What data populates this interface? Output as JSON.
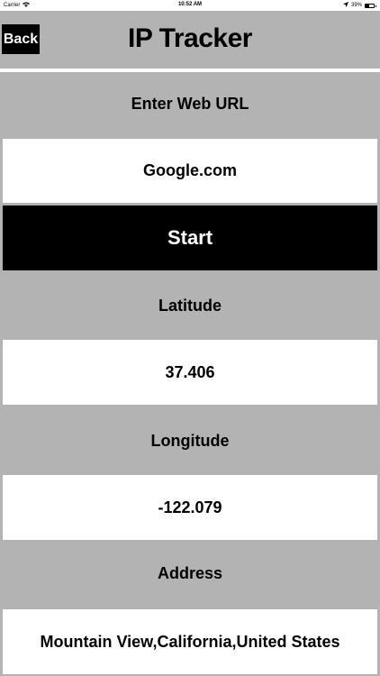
{
  "status_bar": {
    "carrier": "Carrier",
    "time": "10:52 AM",
    "battery": "39%",
    "battery_level": 0.39
  },
  "header": {
    "back_label": "Back",
    "title": "IP Tracker"
  },
  "form": {
    "url_label": "Enter Web URL",
    "url_value": "Google.com",
    "start_label": "Start"
  },
  "results": {
    "latitude_label": "Latitude",
    "latitude_value": "37.406",
    "longitude_label": "Longitude",
    "longitude_value": "-122.079",
    "address_label": "Address",
    "address_value": "Mountain View,California,United States"
  },
  "colors": {
    "background": "#b3b3b3",
    "field": "#ffffff",
    "button": "#000000"
  },
  "icons": [
    "wifi-icon",
    "location-arrow-icon",
    "battery-icon"
  ]
}
